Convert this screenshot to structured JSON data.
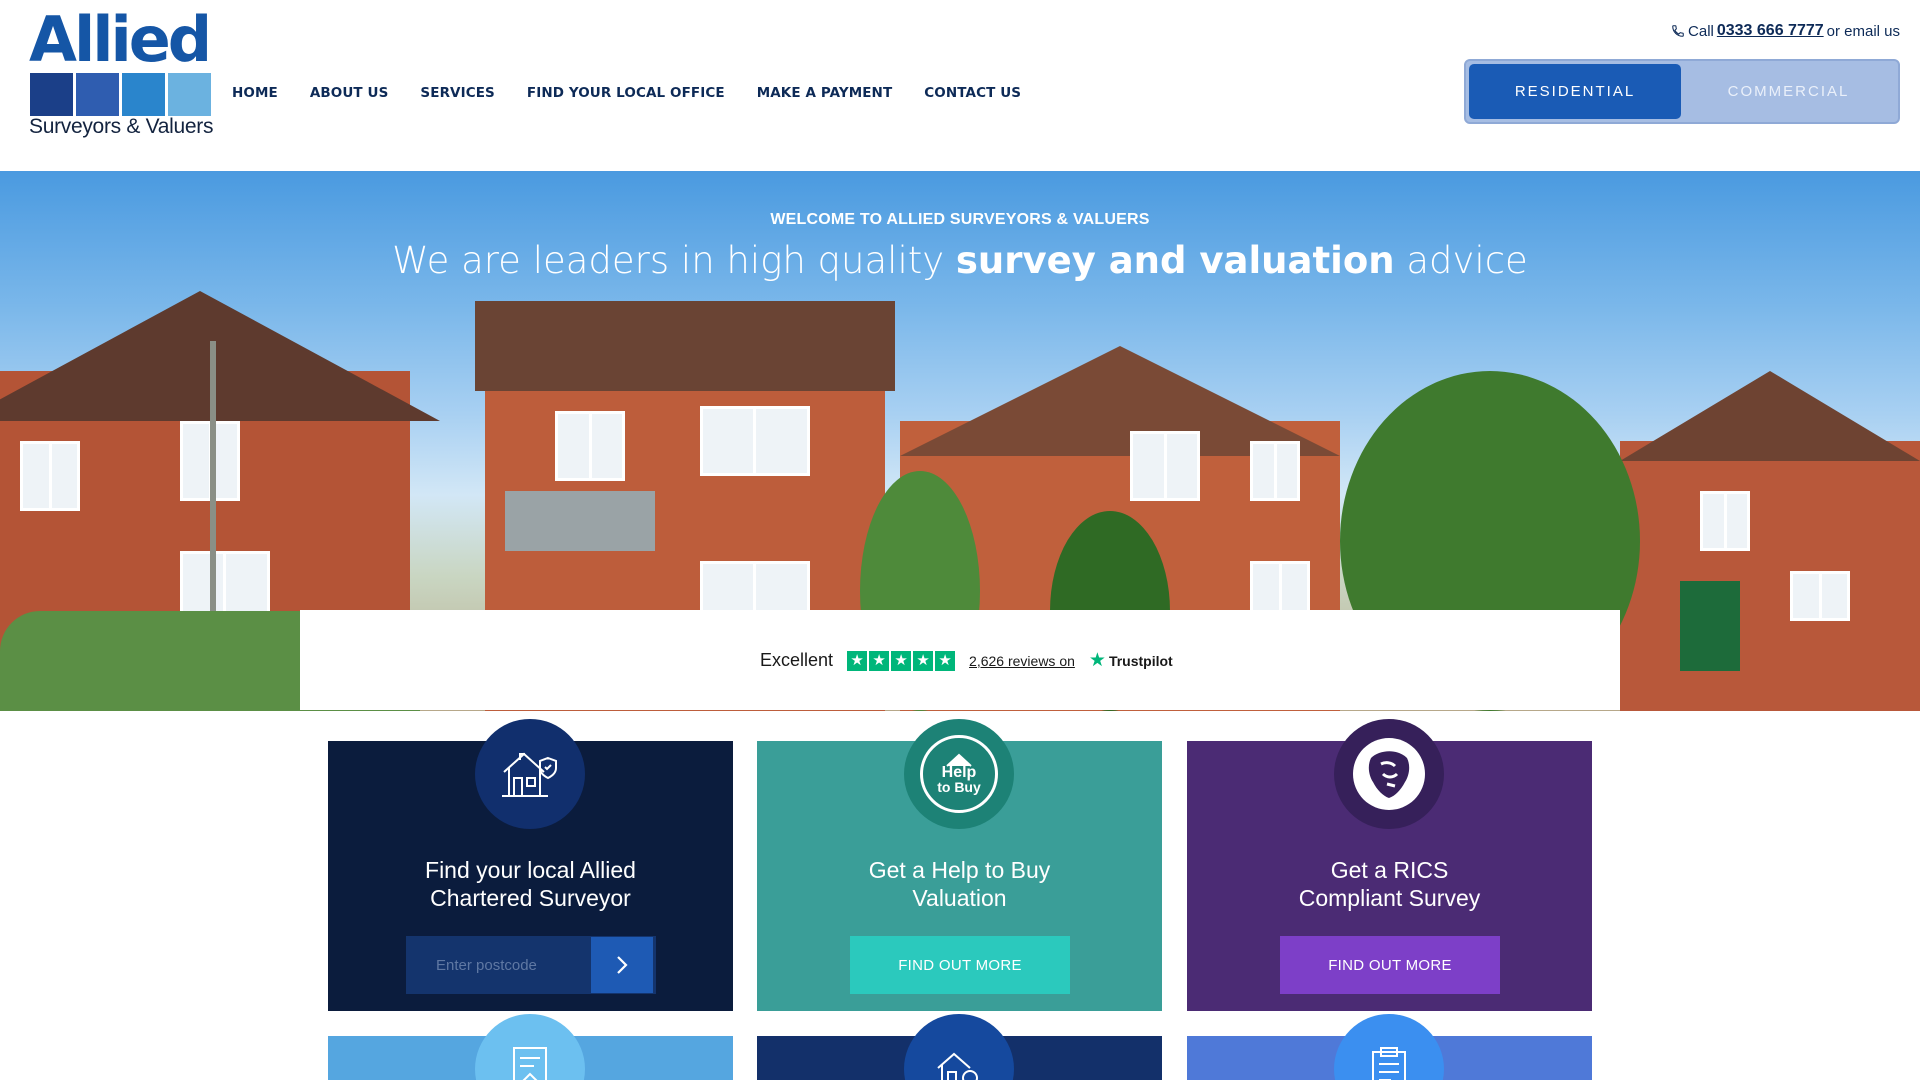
{
  "logo": {
    "word": "Allied",
    "tagline": "Surveyors & Valuers",
    "squares": [
      "#1b3f88",
      "#2f5db0",
      "#2a85cc",
      "#6bb2e0"
    ]
  },
  "nav": {
    "items": [
      {
        "label": "HOME"
      },
      {
        "label": "ABOUT US"
      },
      {
        "label": "SERVICES"
      },
      {
        "label": "FIND YOUR LOCAL OFFICE"
      },
      {
        "label": "MAKE A PAYMENT"
      },
      {
        "label": "CONTACT US"
      }
    ]
  },
  "contact": {
    "prefix": "Call",
    "phone": "0333 666 7777",
    "suffix": "or email us"
  },
  "toggle": {
    "residential": "RESIDENTIAL",
    "commercial": "COMMERCIAL"
  },
  "hero": {
    "kicker": "WELCOME TO ALLIED SURVEYORS & VALUERS",
    "headline_pre": "We are leaders in high quality",
    "headline_bold": "survey and valuation",
    "headline_post": "advice"
  },
  "trustpilot": {
    "rating_word": "Excellent",
    "stars": 5,
    "reviews": "2,626 reviews on",
    "brand": "Trustpilot"
  },
  "cards": [
    {
      "title_line1": "Find your local Allied",
      "title_line2": "Chartered Surveyor",
      "postcode_placeholder": "Enter postcode",
      "color": "#0b1c3d",
      "circle_color": "#112f6d"
    },
    {
      "title_line1": "Get a Help to Buy",
      "title_line2": "Valuation",
      "button": "FIND OUT MORE",
      "badge_line1": "Help",
      "badge_line2": "to Buy",
      "color": "#3a9e98",
      "circle_color": "#1d8276",
      "button_color": "#2bc9bd"
    },
    {
      "title_line1": "Get a RICS",
      "title_line2": "Compliant Survey",
      "button": "FIND OUT MORE",
      "color": "#4b2b74",
      "circle_color": "#36205a",
      "button_color": "#7d3fc8"
    }
  ],
  "cards_row2": [
    {
      "color": "#55a6e0",
      "circle_color": "#6cc0f0"
    },
    {
      "color": "#13306a",
      "circle_color": "#15499e"
    },
    {
      "color": "#4f79d8",
      "circle_color": "#3b8ff0"
    }
  ]
}
